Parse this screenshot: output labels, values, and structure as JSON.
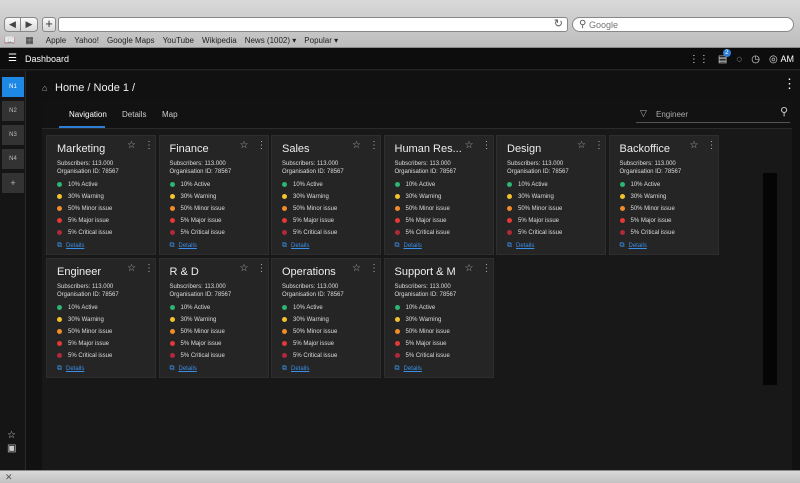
{
  "browser": {
    "back_icon": "◀",
    "forward_icon": "▶",
    "new_tab_icon": "+",
    "search_placeholder": "Google",
    "bookmarks": [
      "Apple",
      "Yahoo!",
      "Google Maps",
      "YouTube",
      "Wikipedia",
      "News (1002) ▾",
      "Popular ▾"
    ]
  },
  "app": {
    "title": "Dashboard",
    "user_initials": "AM",
    "notification_count": "2"
  },
  "sidebar": {
    "items": [
      "N1",
      "N2",
      "N3",
      "N4",
      "+"
    ]
  },
  "breadcrumb": "Home / Node 1 /",
  "tabs": [
    "Navigation",
    "Details",
    "Map"
  ],
  "filter": {
    "value": "Engineer"
  },
  "status_colors": {
    "active": "#2bb673",
    "warning": "#f2c12e",
    "minor": "#f28c28",
    "major": "#e53935",
    "critical": "#b0283a",
    "accent": "#2f7fd6"
  },
  "cards": [
    {
      "title": "Marketing",
      "subscribers": "Subscribers: 113.000",
      "org_id": "Organisation ID: 78567",
      "statuses": [
        "10% Active",
        "30% Warning",
        "50% Minor issue",
        "5% Major issue",
        "5% Critical issue"
      ],
      "details": "Details"
    },
    {
      "title": "Finance",
      "subscribers": "Subscribers: 113.000",
      "org_id": "Organisation ID: 78567",
      "statuses": [
        "10% Active",
        "30% Warning",
        "50% Minor issue",
        "5% Major issue",
        "5% Critical issue"
      ],
      "details": "Details"
    },
    {
      "title": "Sales",
      "subscribers": "Subscribers: 113.000",
      "org_id": "Organisation ID: 78567",
      "statuses": [
        "10% Active",
        "30% Warning",
        "50% Minor issue",
        "5% Major issue",
        "5% Critical issue"
      ],
      "details": "Details"
    },
    {
      "title": "Human Res...",
      "subscribers": "Subscribers: 113.000",
      "org_id": "Organisation ID: 78567",
      "statuses": [
        "10% Active",
        "30% Warning",
        "50% Minor issue",
        "5% Major issue",
        "5% Critical issue"
      ],
      "details": "Details"
    },
    {
      "title": "Design",
      "subscribers": "Subscribers: 113.000",
      "org_id": "Organisation ID: 78567",
      "statuses": [
        "10% Active",
        "30% Warning",
        "50% Minor issue",
        "5% Major issue",
        "5% Critical issue"
      ],
      "details": "Details"
    },
    {
      "title": "Backoffice",
      "subscribers": "Subscribers: 113.000",
      "org_id": "Organisation ID: 78567",
      "statuses": [
        "10% Active",
        "30% Warning",
        "50% Minor issue",
        "5% Major issue",
        "5% Critical issue"
      ],
      "details": "Details"
    },
    {
      "title": "Engineer",
      "subscribers": "Subscribers: 113.000",
      "org_id": "Organisation ID: 78567",
      "statuses": [
        "10% Active",
        "30% Warning",
        "50% Minor issue",
        "5% Major issue",
        "5% Critical issue"
      ],
      "details": "Details"
    },
    {
      "title": "R & D",
      "subscribers": "Subscribers: 113.000",
      "org_id": "Organisation ID: 78567",
      "statuses": [
        "10% Active",
        "30% Warning",
        "50% Minor issue",
        "5% Major issue",
        "5% Critical issue"
      ],
      "details": "Details"
    },
    {
      "title": "Operations",
      "subscribers": "Subscribers: 113.000",
      "org_id": "Organisation ID: 78567",
      "statuses": [
        "10% Active",
        "30% Warning",
        "50% Minor issue",
        "5% Major issue",
        "5% Critical issue"
      ],
      "details": "Details"
    },
    {
      "title": "Support & M",
      "subscribers": "Subscribers: 113.000",
      "org_id": "Organisation ID: 78567",
      "statuses": [
        "10% Active",
        "30% Warning",
        "50% Minor issue",
        "5% Major issue",
        "5% Critical issue"
      ],
      "details": "Details"
    }
  ]
}
